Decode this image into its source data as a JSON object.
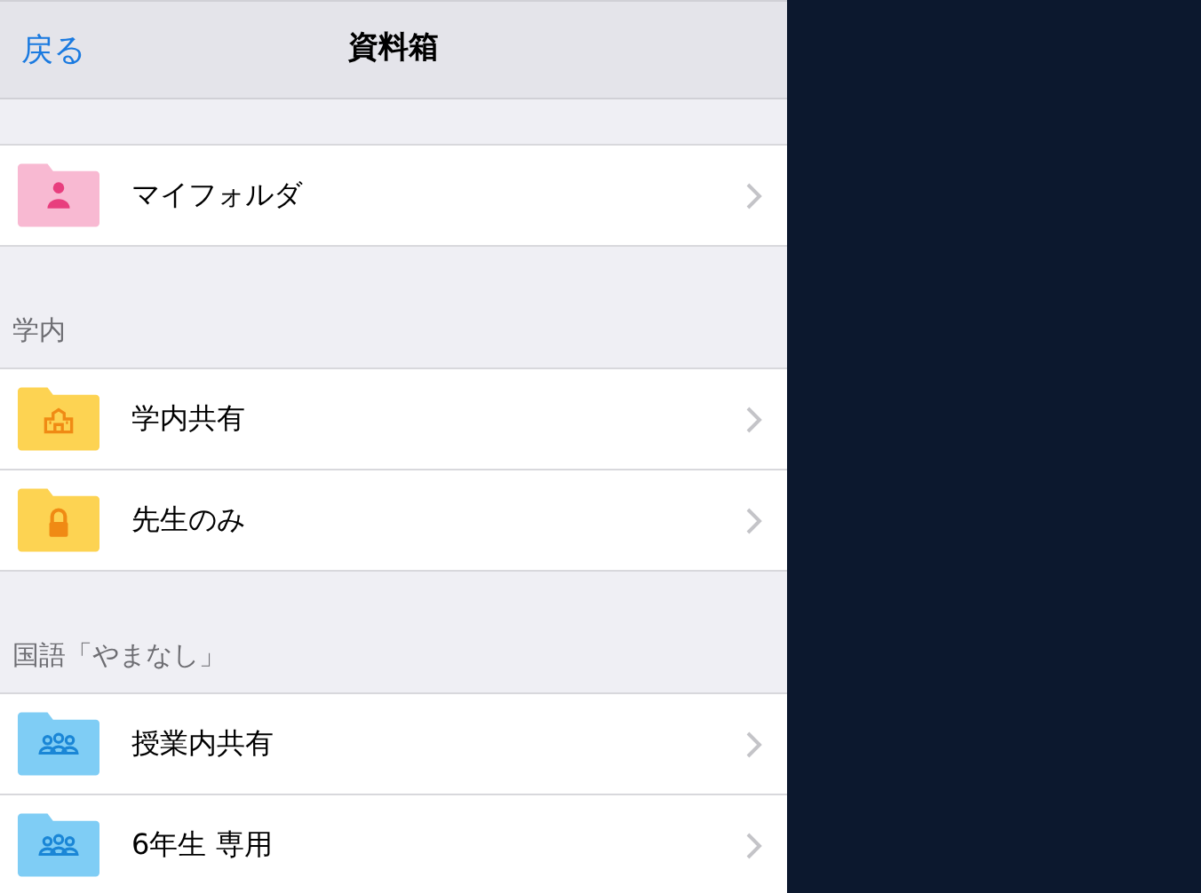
{
  "nav_bar": {
    "back": "戻る",
    "title": "資料箱"
  },
  "sections": [
    {
      "items": [
        {
          "label": "マイフォルダ",
          "kind": "personal"
        }
      ]
    },
    {
      "title": "学内",
      "items": [
        {
          "label": "学内共有",
          "kind": "school"
        },
        {
          "label": "先生のみ",
          "kind": "locked"
        }
      ]
    },
    {
      "title": "国語「やまなし」",
      "items": [
        {
          "label": "授業内共有",
          "kind": "group"
        },
        {
          "label": "6年生 専用",
          "kind": "group"
        }
      ]
    }
  ]
}
